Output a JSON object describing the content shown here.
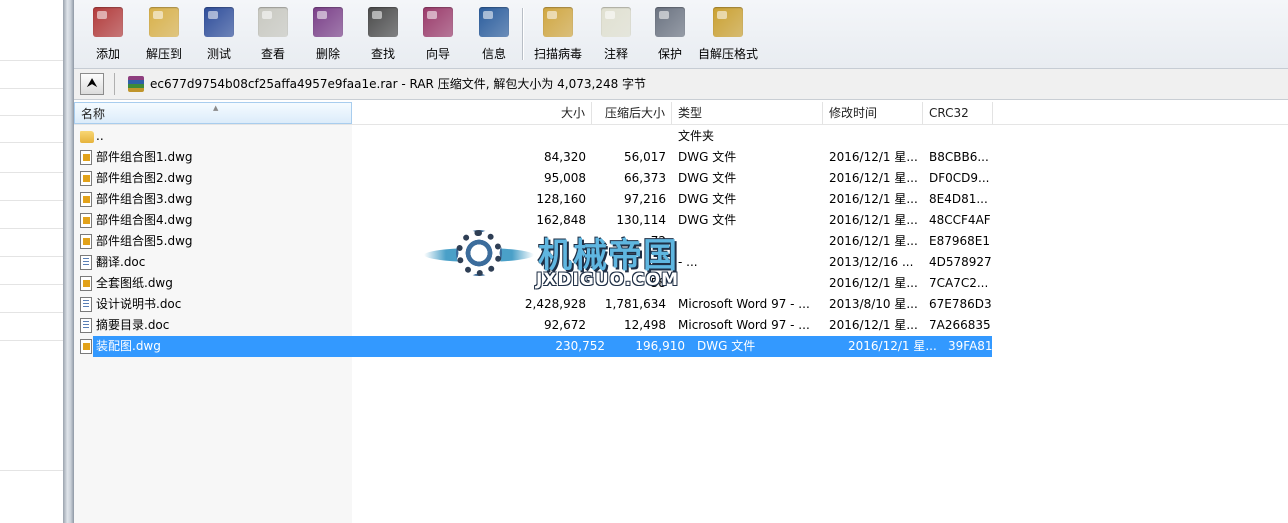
{
  "toolbar": {
    "buttons": [
      {
        "label": "添加",
        "icon": "add-archive-icon",
        "color": "#b23a3a"
      },
      {
        "label": "解压到",
        "icon": "extract-to-icon",
        "color": "#d8b048"
      },
      {
        "label": "测试",
        "icon": "test-icon",
        "color": "#2e4d9a"
      },
      {
        "label": "查看",
        "icon": "view-icon",
        "color": "#c8c8c0"
      },
      {
        "label": "删除",
        "icon": "delete-icon",
        "color": "#7a3f88"
      },
      {
        "label": "查找",
        "icon": "find-icon",
        "color": "#4a4a4a"
      },
      {
        "label": "向导",
        "icon": "wizard-icon",
        "color": "#9a3a6a"
      },
      {
        "label": "信息",
        "icon": "info-icon",
        "color": "#2a5c9c"
      },
      {
        "label": "扫描病毒",
        "icon": "virus-scan-icon",
        "color": "#d0a640"
      },
      {
        "label": "注释",
        "icon": "comment-icon",
        "color": "#e0e0d0"
      },
      {
        "label": "保护",
        "icon": "protect-icon",
        "color": "#6a7280"
      },
      {
        "label": "自解压格式",
        "icon": "sfx-icon",
        "color": "#caa030"
      }
    ]
  },
  "address": {
    "archive_text": "ec677d9754b08cf25affa4957e9faa1e.rar - RAR 压缩文件, 解包大小为 4,073,248 字节"
  },
  "columns": {
    "name": "名称",
    "size": "大小",
    "packed": "压缩后大小",
    "type": "类型",
    "modified": "修改时间",
    "crc": "CRC32"
  },
  "files": [
    {
      "name": "..",
      "size": "",
      "packed": "",
      "type": "文件夹",
      "modified": "",
      "crc": "",
      "icon": "folder"
    },
    {
      "name": "部件组合图1.dwg",
      "size": "84,320",
      "packed": "56,017",
      "type": "DWG 文件",
      "modified": "2016/12/1 星...",
      "crc": "B8CBB6...",
      "icon": "dwg"
    },
    {
      "name": "部件组合图2.dwg",
      "size": "95,008",
      "packed": "66,373",
      "type": "DWG 文件",
      "modified": "2016/12/1 星...",
      "crc": "DF0CD9...",
      "icon": "dwg"
    },
    {
      "name": "部件组合图3.dwg",
      "size": "128,160",
      "packed": "97,216",
      "type": "DWG 文件",
      "modified": "2016/12/1 星...",
      "crc": "8E4D81...",
      "icon": "dwg"
    },
    {
      "name": "部件组合图4.dwg",
      "size": "162,848",
      "packed": "130,114",
      "type": "DWG 文件",
      "modified": "2016/12/1 星...",
      "crc": "48CCF4AF",
      "icon": "dwg"
    },
    {
      "name": "部件组合图5.dwg",
      "size": "",
      "packed": "72",
      "type": "",
      "modified": "2016/12/1 星...",
      "crc": "E87968E1",
      "icon": "dwg"
    },
    {
      "name": "翻译.doc",
      "size": "",
      "packed": "",
      "type": "- ...",
      "modified": "2013/12/16 ...",
      "crc": "4D578927",
      "icon": "doc"
    },
    {
      "name": "全套图纸.dwg",
      "size": "",
      "packed": "58",
      "type": "",
      "modified": "2016/12/1 星...",
      "crc": "7CA7C2...",
      "icon": "dwg"
    },
    {
      "name": "设计说明书.doc",
      "size": "2,428,928",
      "packed": "1,781,634",
      "type": "Microsoft Word 97 - ...",
      "modified": "2013/8/10 星...",
      "crc": "67E786D3",
      "icon": "doc"
    },
    {
      "name": "摘要目录.doc",
      "size": "92,672",
      "packed": "12,498",
      "type": "Microsoft Word 97 - ...",
      "modified": "2016/12/1 星...",
      "crc": "7A266835",
      "icon": "doc"
    },
    {
      "name": "装配图.dwg",
      "size": "230,752",
      "packed": "196,910",
      "type": "DWG 文件",
      "modified": "2016/12/1 星...",
      "crc": "39FA81...",
      "icon": "dwg",
      "selected": true
    }
  ],
  "watermark": {
    "title": "机械帝国",
    "url": "JXDIGUO.COM"
  },
  "colors": {
    "selection": "#3399ff"
  }
}
